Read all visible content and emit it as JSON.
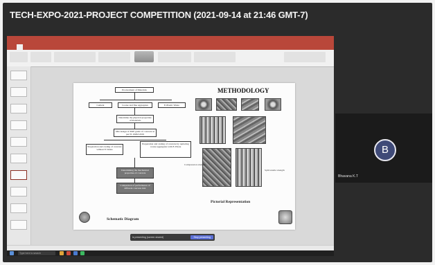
{
  "recording_title": "TECH-EXPO-2021-PROJECT COMPETITION (2021-09-14 at 21:46 GMT-7)",
  "participant": {
    "initial": "B",
    "name": "Bhavana K.T"
  },
  "slide": {
    "heading": "METHODOLOGY",
    "schematic_caption": "Schematic Diagram",
    "pictorial_caption": "Pictorial Representation",
    "flowchart": [
      "Procurement of Materials",
      "Cement",
      "Coarse and fine aggregates",
      "E-Plastic Waste",
      "Determine the physical properties of materials",
      "Mix design of M20 grade of concrete as per IS 10262:2019",
      "Preparation and casting of concrete without E-Waste",
      "Preparation and casting of concrete by replacing coarse aggregates with E-Waste",
      "Determining the mechanical properties of concrete",
      "Comparison of performance of different concrete mix"
    ],
    "photo_labels": [
      "Compression strength",
      "Split tensile strength"
    ]
  },
  "sharing_bar": {
    "message": "is presenting (screen shared)",
    "stop_label": "Stop presenting"
  },
  "taskbar": {
    "search_placeholder": "Type here to search"
  }
}
